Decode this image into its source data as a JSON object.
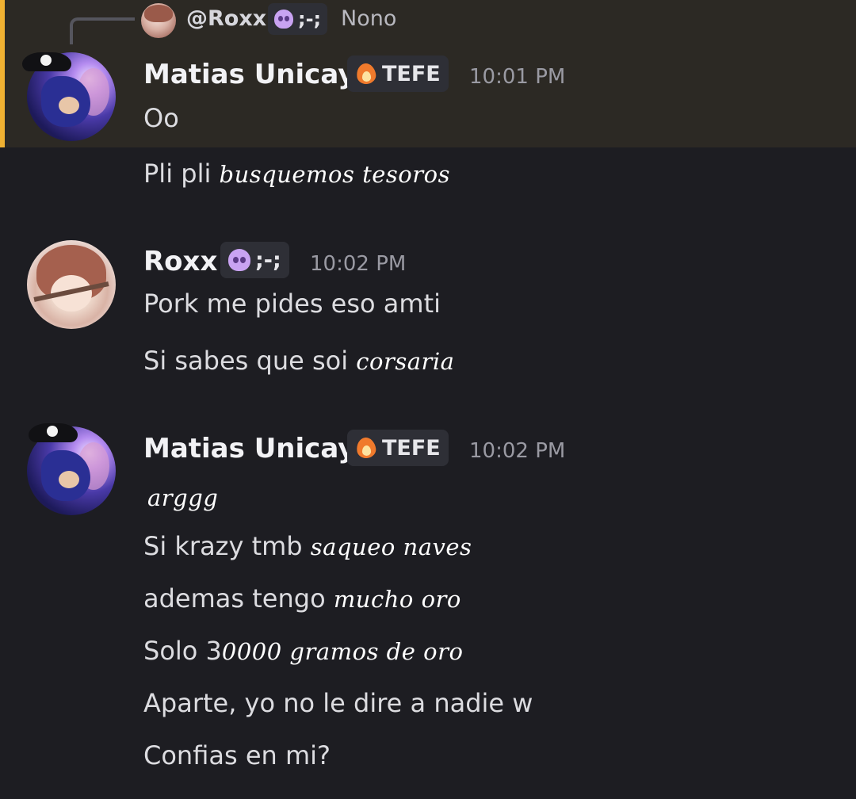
{
  "reply_preview": {
    "name": "@Roxx",
    "badge_text": ";-;",
    "text": "Nono"
  },
  "messages": [
    {
      "author": "Matias Unicay",
      "badge_text": "TEFE",
      "time": "10:01 PM",
      "lines": [
        {
          "text": "Oo"
        },
        {
          "text": "Pli pli",
          "decorated": "busquemos tesoros"
        }
      ]
    },
    {
      "author": "Roxx",
      "badge_text": ";-;",
      "time": "10:02 PM",
      "lines": [
        {
          "text": "Pork me pides eso amti"
        },
        {
          "text": "Si sabes que soi",
          "decorated": "corsaria"
        }
      ]
    },
    {
      "author": "Matias Unicay",
      "badge_text": "TEFE",
      "time": "10:02 PM",
      "lines": [
        {
          "text": "",
          "decorated": "arggg"
        },
        {
          "text": "Si krazy tmb",
          "decorated": "saqueo naves"
        },
        {
          "text": "ademas tengo",
          "decorated": "mucho oro"
        },
        {
          "text": "Solo 3",
          "decorated": "0000 gramos de oro"
        },
        {
          "text": "Aparte, yo no le dire a nadie w"
        },
        {
          "text": "Confias en mi?"
        }
      ]
    }
  ],
  "colors": {
    "background": "#1d1d22",
    "highlight": "#2c2924",
    "highlight_bar": "#f0b132",
    "timestamp": "#9a9aa3"
  }
}
